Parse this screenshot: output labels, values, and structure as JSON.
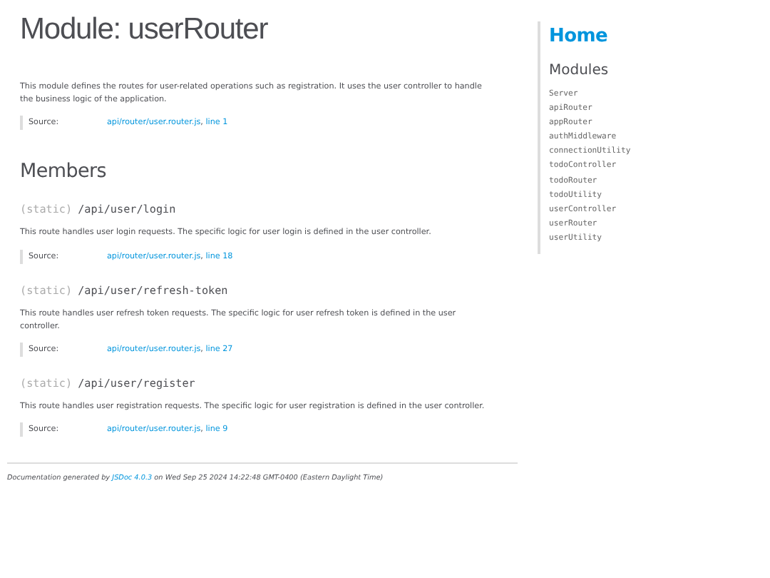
{
  "title": "Module: userRouter",
  "description": "This module defines the routes for user-related operations such as registration. It uses the user controller to handle the business logic of the application.",
  "source": {
    "label": "Source:",
    "file": "api/router/user.router.js",
    "separator": ",",
    "line": "line 1"
  },
  "members_heading": "Members",
  "members": [
    {
      "attribs": "(static)",
      "name": "/api/user/login",
      "description": "This route handles user login requests. The specific logic for user login is defined in the user controller.",
      "source": {
        "label": "Source:",
        "file": "api/router/user.router.js",
        "separator": ",",
        "line": "line 18"
      }
    },
    {
      "attribs": "(static)",
      "name": "/api/user/refresh-token",
      "description": "This route handles user refresh token requests. The specific logic for user refresh token is defined in the user controller.",
      "source": {
        "label": "Source:",
        "file": "api/router/user.router.js",
        "separator": ",",
        "line": "line 27"
      }
    },
    {
      "attribs": "(static)",
      "name": "/api/user/register",
      "description": "This route handles user registration requests. The specific logic for user registration is defined in the user controller.",
      "source": {
        "label": "Source:",
        "file": "api/router/user.router.js",
        "separator": ",",
        "line": "line 9"
      }
    }
  ],
  "footer": {
    "prefix": "Documentation generated by",
    "link": "JSDoc 4.0.3",
    "suffix": "on Wed Sep 25 2024 14:22:48 GMT-0400 (Eastern Daylight Time)"
  },
  "nav": {
    "home": "Home",
    "heading": "Modules",
    "items": [
      "Server",
      "apiRouter",
      "appRouter",
      "authMiddleware",
      "connectionUtility",
      "todoController",
      "todoRouter",
      "todoUtility",
      "userController",
      "userRouter",
      "userUtility"
    ]
  }
}
